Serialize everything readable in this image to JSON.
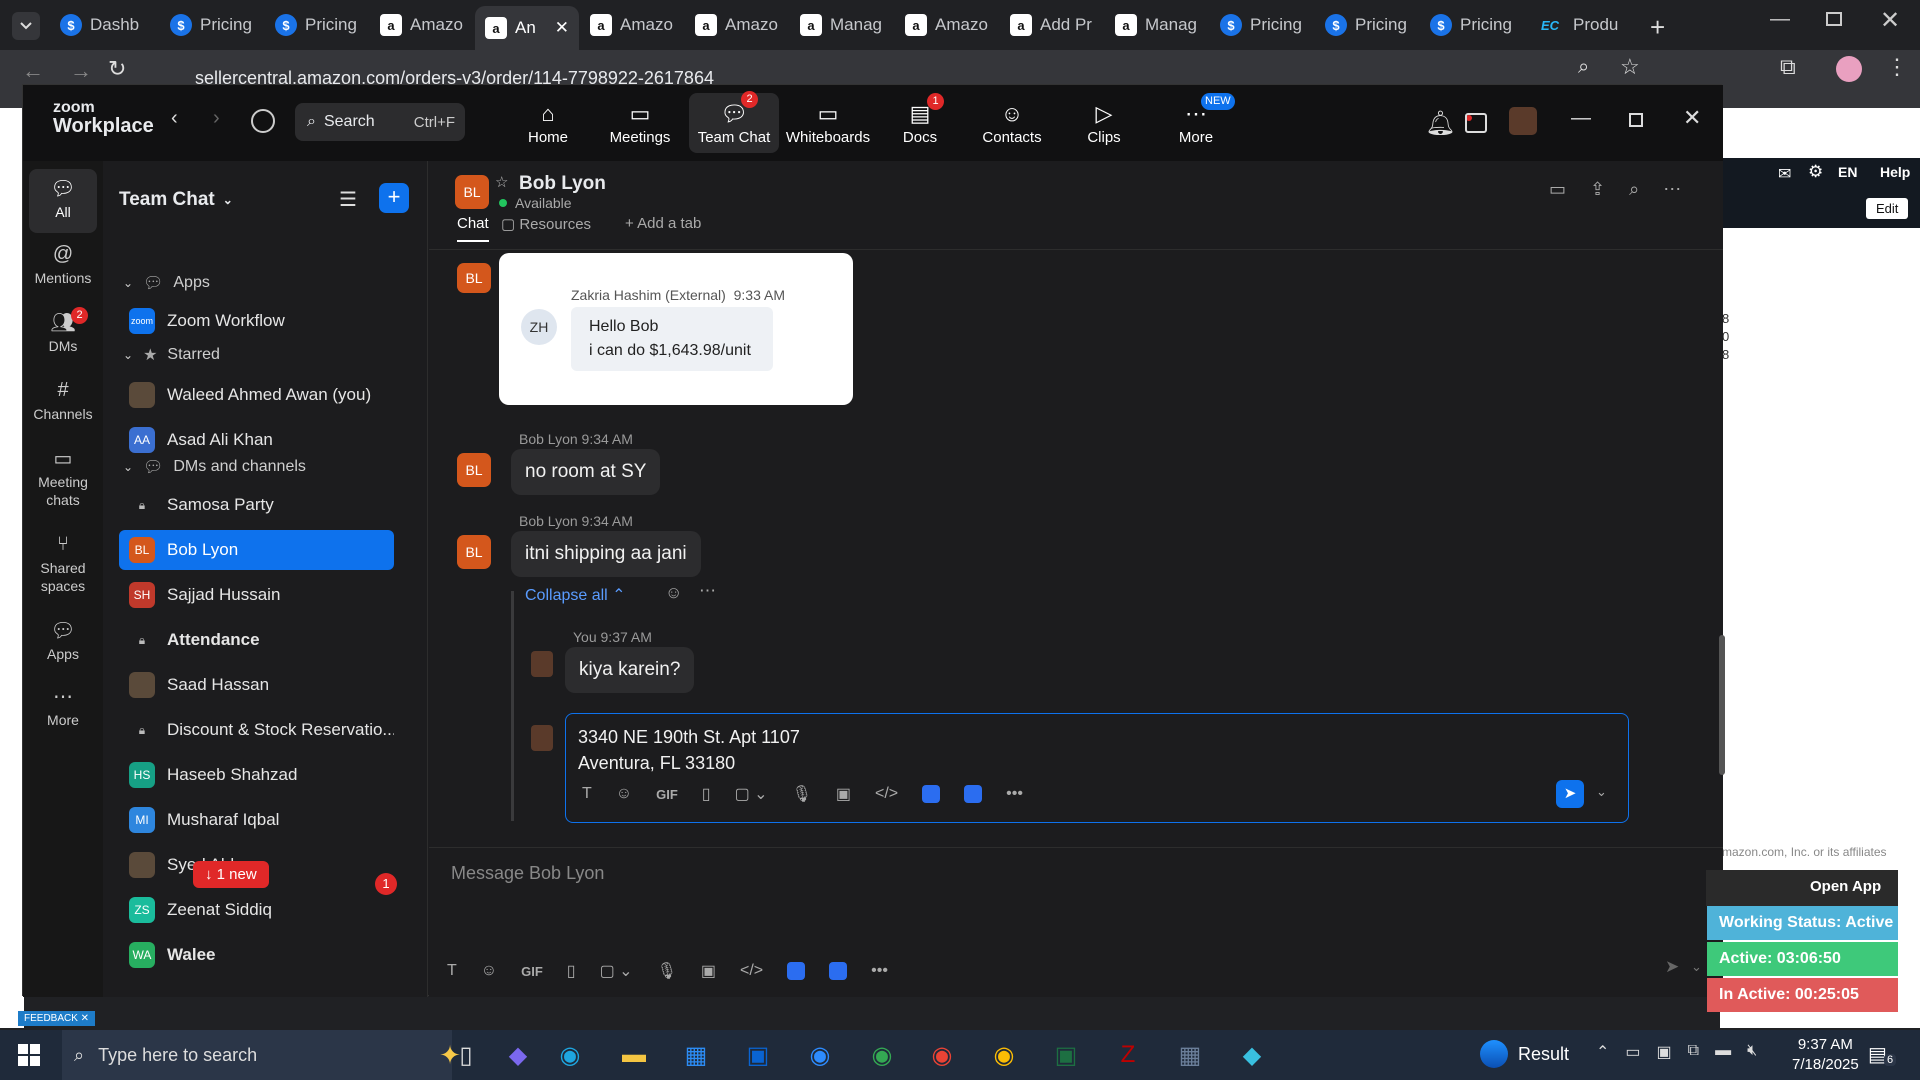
{
  "browser": {
    "tabs": [
      "Dashb",
      "Pricing",
      "Pricing",
      "Amazo",
      "An",
      "Amazo",
      "Amazo",
      "Manag",
      "Amazo",
      "Add Pr",
      "Manag",
      "Pricing",
      "Pricing",
      "Pricing",
      "Produ"
    ],
    "url": "sellercentral.amazon.com/orders-v3/order/114-7798922-2617864"
  },
  "zoom": {
    "brand_line1": "zoom",
    "brand_line2": "Workplace",
    "search_label": "Search",
    "search_shortcut": "Ctrl+F",
    "nav": [
      {
        "label": "Home",
        "icon": "home-icon",
        "badge": ""
      },
      {
        "label": "Meetings",
        "icon": "meetings-icon",
        "badge": ""
      },
      {
        "label": "Team Chat",
        "icon": "team-chat-icon",
        "badge": "2"
      },
      {
        "label": "Whiteboards",
        "icon": "whiteboards-icon",
        "badge": ""
      },
      {
        "label": "Docs",
        "icon": "docs-icon",
        "badge": "1"
      },
      {
        "label": "Contacts",
        "icon": "contacts-icon",
        "badge": ""
      },
      {
        "label": "Clips",
        "icon": "clips-icon",
        "badge": ""
      },
      {
        "label": "More",
        "icon": "more-icon",
        "badge": "NEW"
      }
    ],
    "rail": [
      {
        "label": "All",
        "badge": ""
      },
      {
        "label": "Mentions",
        "badge": ""
      },
      {
        "label": "DMs",
        "badge": "2"
      },
      {
        "label": "Channels",
        "badge": ""
      },
      {
        "label": "Meeting chats",
        "badge": ""
      },
      {
        "label": "Shared spaces",
        "badge": ""
      },
      {
        "label": "Apps",
        "badge": ""
      },
      {
        "label": "More",
        "badge": ""
      }
    ],
    "sidebar": {
      "title": "Team Chat",
      "sections": {
        "apps": "Apps",
        "starred": "Starred",
        "dms": "DMs and channels"
      },
      "apps_items": [
        {
          "name": "Zoom Workflow",
          "initials": "zoom"
        }
      ],
      "starred_items": [
        {
          "name": "Waleed Ahmed Awan (you)",
          "initials": "",
          "bold": false
        },
        {
          "name": "Asad Ali Khan",
          "initials": "AA",
          "bold": false
        }
      ],
      "dm_items": [
        {
          "name": "Samosa Party",
          "initials": "",
          "bold": false
        },
        {
          "name": "Bob Lyon",
          "initials": "BL",
          "bold": false
        },
        {
          "name": "Sajjad Hussain",
          "initials": "SH",
          "bold": false
        },
        {
          "name": "Attendance",
          "initials": "",
          "bold": true
        },
        {
          "name": "Saad Hassan",
          "initials": "",
          "bold": false
        },
        {
          "name": "Discount & Stock Reservatio...",
          "initials": "",
          "bold": false
        },
        {
          "name": "Haseeb Shahzad",
          "initials": "HS",
          "bold": false
        },
        {
          "name": "Musharaf Iqbal",
          "initials": "MI",
          "bold": false
        },
        {
          "name": "Syed Abbas",
          "initials": "",
          "bold": false
        },
        {
          "name": "Zeenat Siddiq",
          "initials": "ZS",
          "bold": false
        },
        {
          "name": "Walee",
          "initials": "WA",
          "bold": true
        }
      ],
      "new_pill": "1 new",
      "unread_count": "1"
    },
    "chat": {
      "contact_name": "Bob Lyon",
      "contact_initials": "BL",
      "status": "Available",
      "tabs": [
        "Chat",
        "Resources",
        "Add a tab"
      ],
      "quoted": {
        "initials": "ZH",
        "sender": "Zakria Hashim (External)",
        "time": "9:33 AM",
        "line1": "Hello Bob",
        "line2": "i can do $1,643.98/unit"
      },
      "messages": [
        {
          "sender": "Bob Lyon",
          "time": "9:34 AM",
          "text": "no room at SY"
        },
        {
          "sender": "Bob Lyon",
          "time": "9:34 AM",
          "text": "itni shipping aa jani"
        }
      ],
      "thread_toggle": "Collapse all",
      "reply": {
        "sender": "You",
        "time": "9:37 AM",
        "text": "kiya karein?"
      },
      "draft_line1": "3340 NE 190th St. Apt 1107",
      "draft_line2": "Aventura, FL 33180",
      "composer_placeholder": "Message Bob Lyon",
      "gif_label": "GIF"
    }
  },
  "amazon": {
    "edit": "Edit",
    "lang": "EN",
    "help": "Help",
    "footer": "mazon.com, Inc. or its affiliates",
    "nums": [
      "8",
      "0",
      "8"
    ],
    "feedback": "FEEDBACK"
  },
  "widget": {
    "open_app": "Open App",
    "working_status": "Working Status: Active",
    "active": "Active: 03:06:50",
    "inactive": "In Active: 00:25:05"
  },
  "taskbar": {
    "search_placeholder": "Type here to search",
    "weather": "Result",
    "time": "9:37 AM",
    "date": "7/18/2025",
    "notif_count": "6"
  },
  "colors": {
    "accent": "#0e72ed",
    "avatar_bl": "#d4571c",
    "online": "#22c55e",
    "badge": "#e02828"
  }
}
